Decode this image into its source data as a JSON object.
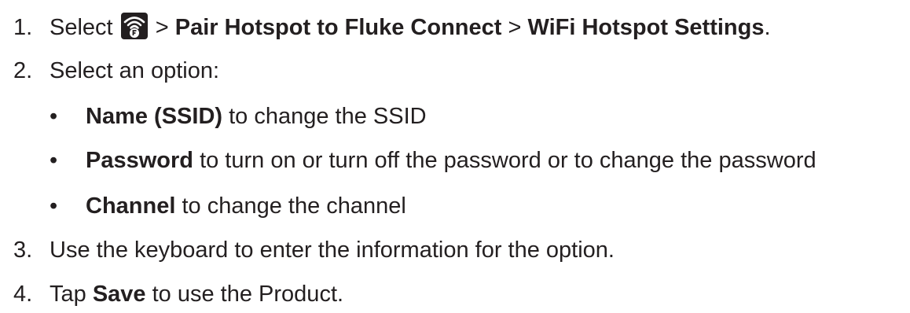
{
  "steps": [
    {
      "number": "1.",
      "parts": {
        "select": "Select",
        "icon": "wifi-hotspot-icon",
        "sep1": ">",
        "pair": "Pair Hotspot to Fluke Connect",
        "sep2": ">",
        "settings": "WiFi Hotspot Settings",
        "end": "."
      }
    },
    {
      "number": "2.",
      "text": "Select an option:"
    },
    {
      "number": "3.",
      "text": "Use the keyboard to enter the information for the option."
    },
    {
      "number": "4.",
      "pre": "Tap",
      "bold": "Save",
      "post": "to use the Product."
    }
  ],
  "options": [
    {
      "bullet": "•",
      "bold": "Name (SSID)",
      "text": "to change the SSID"
    },
    {
      "bullet": "•",
      "bold": "Password",
      "text": "to turn on or turn off the password or to change the password"
    },
    {
      "bullet": "•",
      "bold": "Channel",
      "text": "to change the channel"
    }
  ],
  "colors": {
    "text": "#231f20",
    "icon": "#231f20"
  }
}
